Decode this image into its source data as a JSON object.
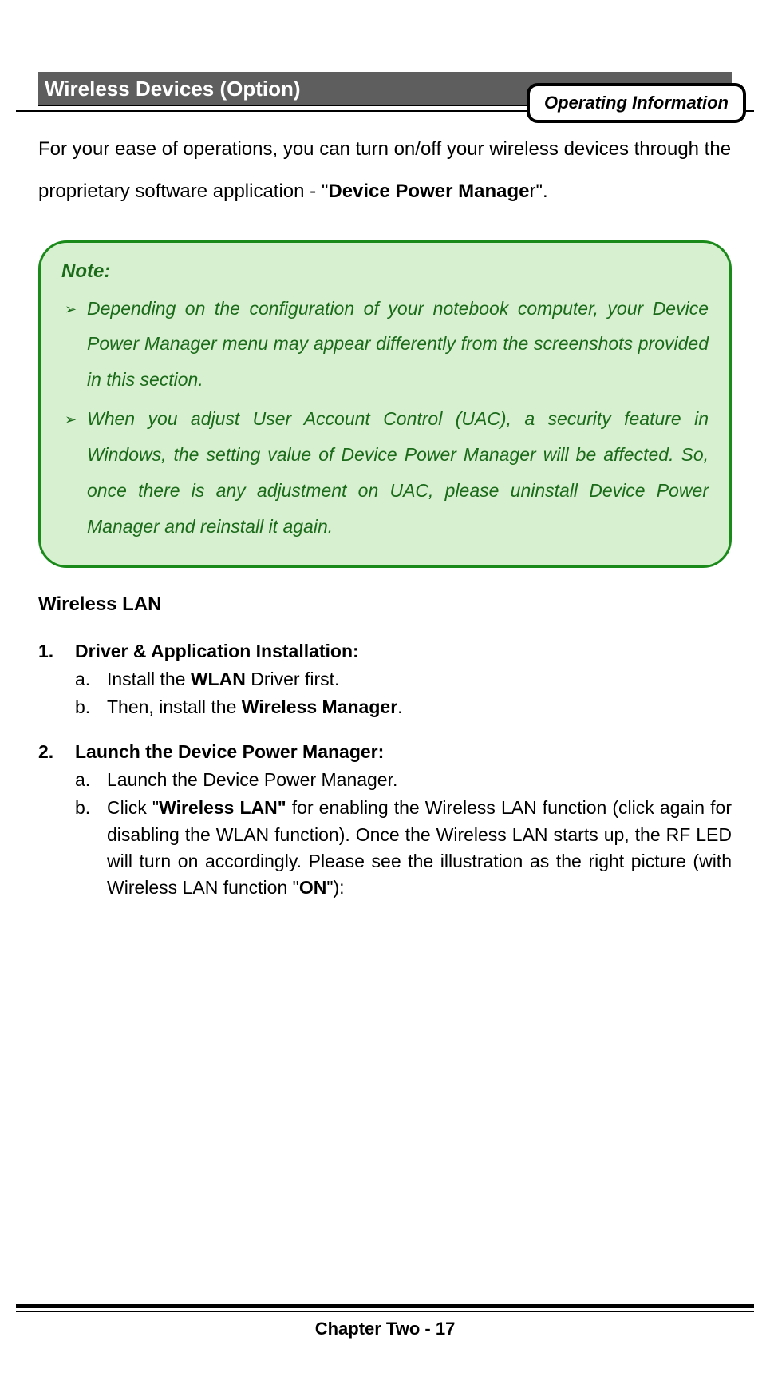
{
  "header": {
    "badge": "Operating Information"
  },
  "section_title": " Wireless Devices (Option)",
  "intro": {
    "pre": "For your ease of operations, you can turn on/off your wireless devices through the proprietary software application - \"",
    "bold": "Device Power Manage",
    "post": "r\"."
  },
  "note": {
    "label": "Note:",
    "items": [
      "Depending on the configuration of your notebook computer, your Device Power Manager menu may appear differently from the screenshots provided in this section.",
      "When you adjust User Account Control (UAC), a security feature in Windows, the setting value of Device Power Manager will be affected. So, once there is any adjustment on UAC, please uninstall Device Power Manager and reinstall it again."
    ]
  },
  "subheading": "Wireless LAN",
  "steps": [
    {
      "title": "Driver & Application Installation:",
      "subs": [
        {
          "pre": "Install the ",
          "b1": "WLAN",
          "post": " Driver first."
        },
        {
          "pre": "Then, install the ",
          "b1": "Wireless Manager",
          "post": "."
        }
      ]
    },
    {
      "title": "Launch the Device Power Manager:",
      "subs": [
        {
          "pre": "Launch the Device Power Manager.",
          "b1": "",
          "post": ""
        },
        {
          "pre": "Click \"",
          "b1": "Wireless LAN\"",
          "mid": " for enabling the Wireless LAN function (click again for disabling the WLAN function). Once the Wireless LAN starts up, the RF LED will turn on accordingly. Please see the illustration as the right picture (with Wireless LAN function \"",
          "b2": "ON",
          "post": "\"):"
        }
      ]
    }
  ],
  "footer": "Chapter Two - 17"
}
